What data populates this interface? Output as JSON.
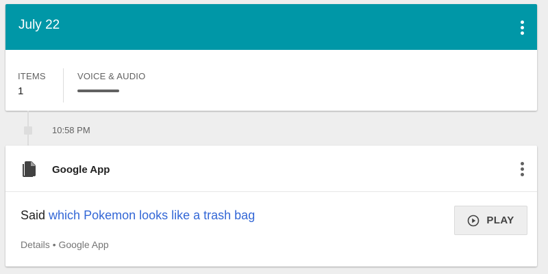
{
  "header": {
    "date": "July 22"
  },
  "stats": {
    "items_label": "ITEMS",
    "items_value": "1",
    "voice_label": "VOICE & AUDIO"
  },
  "timeline": {
    "time": "10:58 PM"
  },
  "activity": {
    "app_name": "Google App",
    "said_prefix": "Said",
    "query": "which Pokemon looks like a trash bag",
    "details_link": "Details",
    "separator": "•",
    "source": "Google App",
    "play_label": "PLAY"
  },
  "icons": {
    "header_menu": "more-vert-icon",
    "item_menu": "more-vert-icon",
    "app": "documents-icon",
    "play": "play-circle-icon"
  },
  "colors": {
    "header_bg": "#0097a7",
    "link": "#3367d6",
    "page_bg": "#eeeeee"
  }
}
